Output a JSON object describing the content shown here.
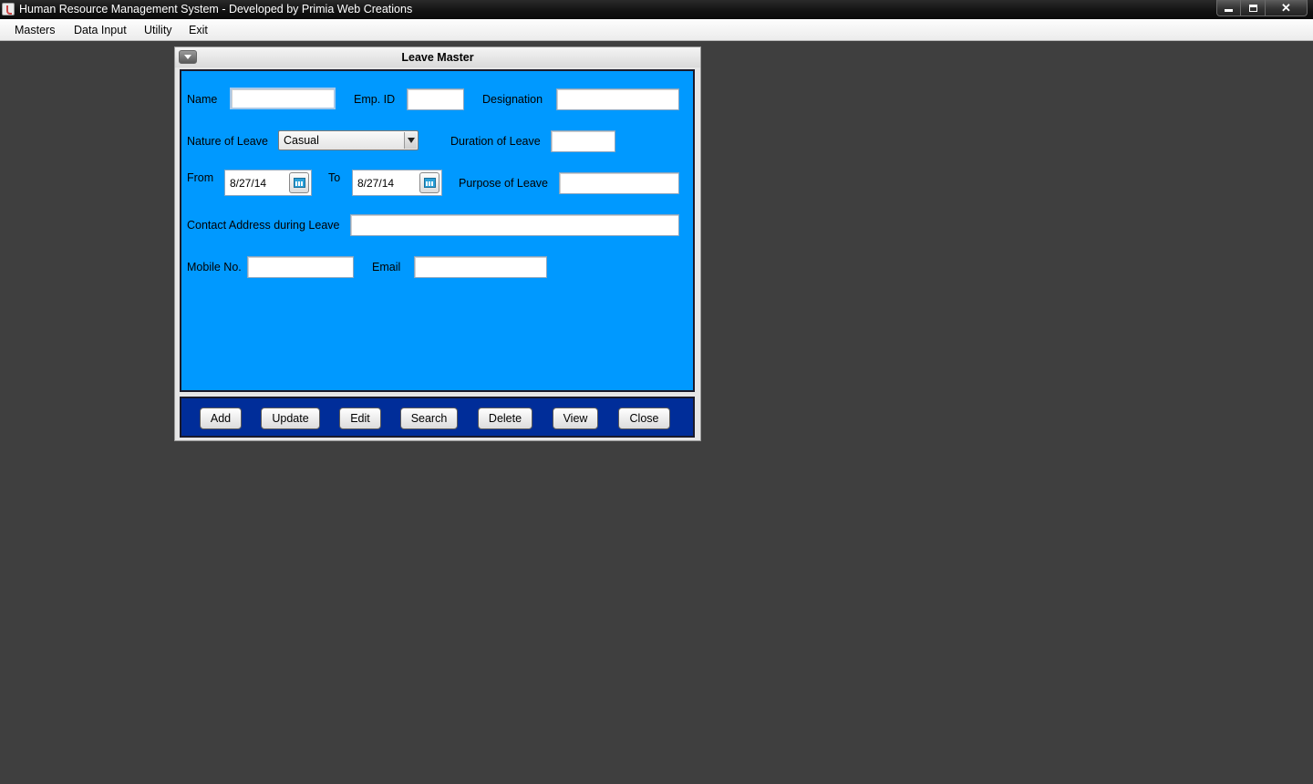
{
  "window": {
    "title": "Human Resource Management System - Developed by Primia Web Creations"
  },
  "menubar": {
    "items": [
      "Masters",
      "Data Input",
      "Utility",
      "Exit"
    ]
  },
  "form": {
    "title": "Leave Master",
    "labels": {
      "name": "Name",
      "emp_id": "Emp. ID",
      "designation": "Designation",
      "nature_of_leave": "Nature of Leave",
      "duration_of_leave": "Duration of Leave",
      "from": "From",
      "to": "To",
      "purpose_of_leave": "Purpose of Leave",
      "contact_address": "Contact Address during Leave",
      "mobile_no": "Mobile No.",
      "email": "Email"
    },
    "values": {
      "name": "",
      "emp_id": "",
      "designation": "",
      "nature_of_leave": "Casual",
      "duration_of_leave": "",
      "from_date": "8/27/14",
      "to_date": "8/27/14",
      "purpose_of_leave": "",
      "contact_address": "",
      "mobile_no": "",
      "email": ""
    }
  },
  "buttons": [
    "Add",
    "Update",
    "Edit",
    "Search",
    "Delete",
    "View",
    "Close"
  ]
}
